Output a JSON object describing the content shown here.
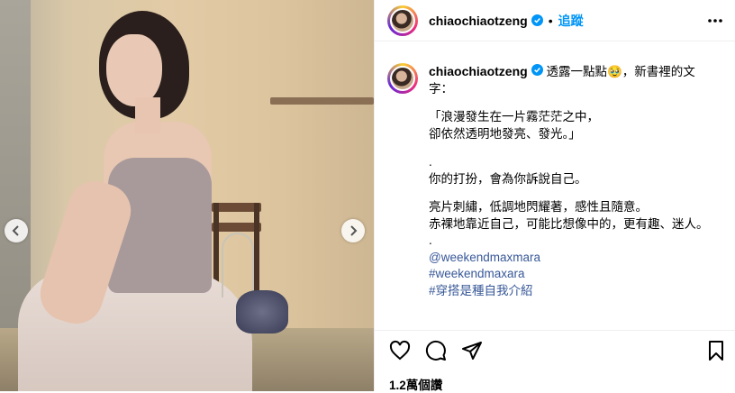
{
  "header": {
    "username": "chiaochiaotzeng",
    "separator": "•",
    "follow_label": "追蹤"
  },
  "caption": {
    "username": "chiaochiaotzeng",
    "first_line": "透露一點點",
    "first_line_emoji": "🥹",
    "first_line_rest": "，新書裡的文",
    "second_line": "字：",
    "quote_line1": "「浪漫發生在一片霧茫茫之中，",
    "quote_line2": "卻依然透明地發亮、發光。」",
    "dot1": ".",
    "line_dress": "你的打扮，會為你訴說自己。",
    "line_sequins": "亮片刺繡，低調地閃耀著，感性且隨意。",
    "line_bare": "赤裸地靠近自己，可能比想像中的，更有趣、迷人。",
    "dot2": ".",
    "links": [
      "@weekendmaxmara",
      "#weekendmaxara",
      "#穿搭是種自我介紹"
    ]
  },
  "stats": {
    "views": "1.2萬個讚"
  },
  "colors": {
    "link": "#385898",
    "follow": "#0095f6"
  }
}
